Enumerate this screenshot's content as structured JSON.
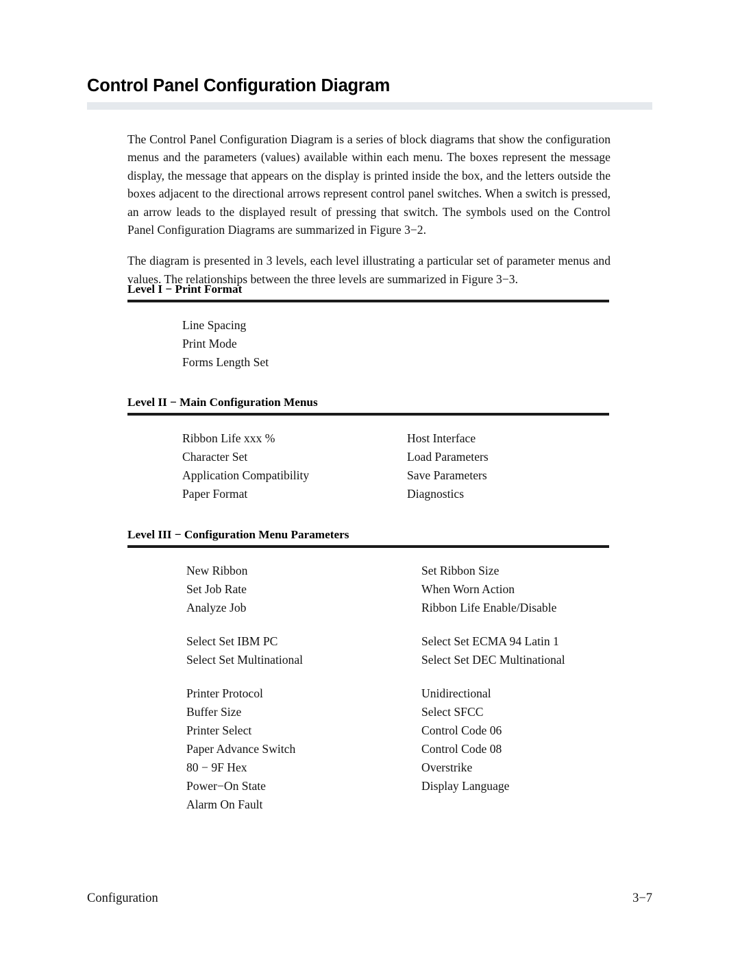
{
  "document": {
    "title": "Control Panel Configuration Diagram",
    "paragraphs": [
      "The Control Panel Configuration Diagram is a series of block diagrams that show the configuration menus and the parameters (values) available within each menu. The boxes represent the message display, the message that appears on the display is printed inside the box, and the letters outside the boxes adjacent to the directional arrows represent control panel switches. When a switch is pressed, an arrow leads to the displayed result of pressing that switch. The symbols used on the Control Panel Configuration Diagrams are summarized in Figure 3−2.",
      "The diagram is presented in 3 levels, each level illustrating a particular set of parameter menus and values. The relationships between the three levels are summarized in Figure 3−3."
    ],
    "levels": [
      {
        "heading": "Level I − Print Format",
        "groups": [
          {
            "rows": [
              {
                "col_a": "Line Spacing",
                "col_b": ""
              },
              {
                "col_a": "Print Mode",
                "col_b": ""
              },
              {
                "col_a": "Forms Length Set",
                "col_b": ""
              }
            ]
          }
        ]
      },
      {
        "heading": "Level II − Main Configuration Menus",
        "groups": [
          {
            "rows": [
              {
                "col_a": "Ribbon Life xxx %",
                "col_b": "Host Interface"
              },
              {
                "col_a": "Character Set",
                "col_b": "Load Parameters"
              },
              {
                "col_a": "Application Compatibility",
                "col_b": "Save Parameters"
              },
              {
                "col_a": "Paper Format",
                "col_b": "Diagnostics"
              }
            ]
          }
        ]
      },
      {
        "heading": "Level III − Configuration Menu Parameters",
        "groups": [
          {
            "rows": [
              {
                "col_a": "New Ribbon",
                "col_b": "Set Ribbon Size"
              },
              {
                "col_a": "Set Job Rate",
                "col_b": "When Worn Action"
              },
              {
                "col_a": "Analyze Job",
                "col_b": "Ribbon Life Enable/Disable"
              }
            ]
          },
          {
            "rows": [
              {
                "col_a": "Select Set IBM PC",
                "col_b": "Select Set ECMA 94 Latin 1"
              },
              {
                "col_a": "Select Set Multinational",
                "col_b": "Select Set DEC Multinational"
              }
            ]
          },
          {
            "rows": [
              {
                "col_a": "Printer Protocol",
                "col_b": "Unidirectional"
              },
              {
                "col_a": "Buffer Size",
                "col_b": "Select SFCC"
              },
              {
                "col_a": "Printer Select",
                "col_b": "Control Code 06"
              },
              {
                "col_a": "Paper Advance Switch",
                "col_b": "Control Code 08"
              },
              {
                "col_a": "80 − 9F Hex",
                "col_b": "Overstrike"
              },
              {
                "col_a": "Power−On State",
                "col_b": "Display Language"
              },
              {
                "col_a": "Alarm On Fault",
                "col_b": ""
              }
            ]
          }
        ]
      }
    ],
    "footer": {
      "left": "Configuration",
      "right": "3−7"
    },
    "colors": {
      "title_rule": "#e5e9ed",
      "heading_rule": "#1b1b1b",
      "text": "#121212"
    }
  }
}
